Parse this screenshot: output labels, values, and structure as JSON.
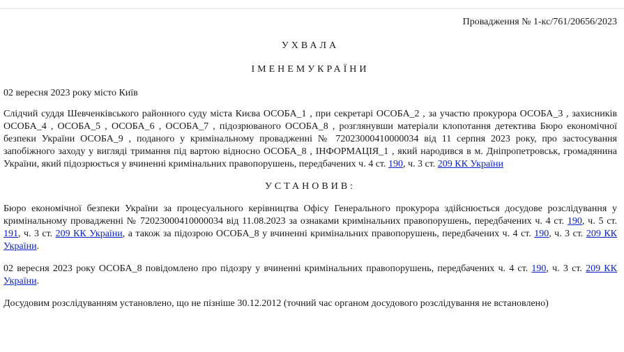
{
  "header": {
    "case_number": "Провадження № 1-кс/761/20656/2023"
  },
  "title": "УХВАЛА",
  "subtitle": "ІМЕНЕМУКРАЇНИ",
  "date_place": "02 вересня 2023 року місто Київ",
  "intro": {
    "text": "Слідчий суддя Шевченківського районного суду міста Києва ОСОБА_1 , при секретарі ОСОБА_2 , за участю прокурора ОСОБА_3 , захисників ОСОБА_4 , ОСОБА_5 , ОСОБА_6 , ОСОБА_7 , підозрюваного ОСОБА_8 , розглянувши матеріали клопотання детектива Бюро економічної безпеки України ОСОБА_9 , поданого у кримінальному провадженні № 72023000410000034 від 11 серпня 2023 року, про застосування запобіжного заходу у вигляді тримання під вартою відносно ОСОБА_8 , ІНФОРМАЦІЯ_1 , який народився в м. Дніпропетровськ, громадянина України, який підозрюється у вчиненні кримінальних правопорушень, передбачених ч. 4 ст. ",
    "link1": "190",
    "mid1": ", ч. 3 ст. ",
    "link2": "209 КК України"
  },
  "section_heading": "УСТАНОВИВ:",
  "paragraph1": {
    "text": "Бюро економічної безпеки України за процесуального керівництва Офісу Генерального прокурора здійснюється досудове розслідування у кримінальному провадженні № 72023000410000034 від 11.08.2023 за ознаками кримінальних правопорушень, передбачених ч. 4 ст. ",
    "link1": "190",
    "mid1": ", ч. 5 ст. ",
    "link2": "191",
    "mid2": ", ч. 3 ст. ",
    "link3": "209 КК України",
    "mid3": ", а також за підозрою ОСОБА_8 у вчиненні кримінальних правопорушень, передбачених ч. 4 ст. ",
    "link4": "190",
    "mid4": ", ч. 3 ст. ",
    "link5": "209 КК України",
    "end": "."
  },
  "paragraph2": {
    "text": "02 вересня 2023 року ОСОБА_8 повідомлено про підозру у вчиненні кримінальних правопорушень, передбачених ч. 4 ст. ",
    "link1": "190",
    "mid1": ", ч. 3 ст. ",
    "link2": "209 КК України",
    "end": "."
  },
  "paragraph3": {
    "text": "Досудовим розслідуванням установлено, що не пізніше 30.12.2012 (точний час органом досудового розслідування не встановлено)"
  }
}
